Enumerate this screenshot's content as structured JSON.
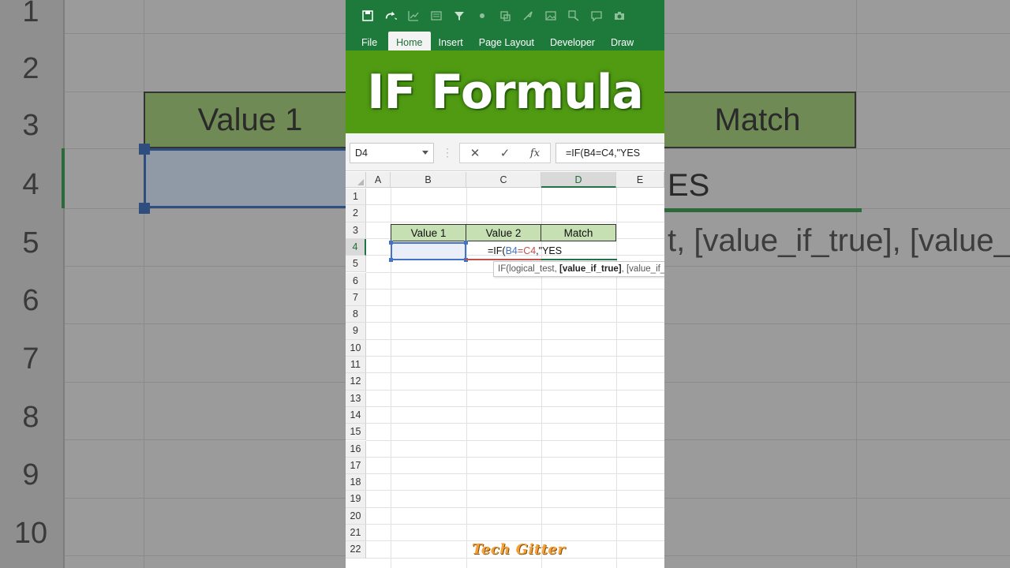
{
  "app": {
    "name": "Excel"
  },
  "quick_access": [
    {
      "icon": "autosave-icon"
    },
    {
      "icon": "redo-icon"
    },
    {
      "icon": "chart-icon"
    },
    {
      "icon": "form-icon"
    },
    {
      "icon": "filter-icon"
    },
    {
      "icon": "circle-icon"
    },
    {
      "icon": "shapes-icon"
    },
    {
      "icon": "brush-icon"
    },
    {
      "icon": "picture-icon"
    },
    {
      "icon": "replace-icon"
    },
    {
      "icon": "comment-icon"
    },
    {
      "icon": "camera-icon"
    }
  ],
  "ribbon": {
    "tabs": [
      {
        "label": "File"
      },
      {
        "label": "Home",
        "active": true
      },
      {
        "label": "Insert"
      },
      {
        "label": "Page Layout"
      },
      {
        "label": "Developer"
      },
      {
        "label": "Draw"
      }
    ]
  },
  "banner": {
    "title": "IF Formula"
  },
  "formula_bar": {
    "name_box": "D4",
    "formula": "=IF(B4=C4,\"YES",
    "cancel_icon": "close-icon",
    "enter_icon": "check-icon",
    "function_icon": "fx"
  },
  "sheet": {
    "columns": [
      "A",
      "B",
      "C",
      "D",
      "E"
    ],
    "active_column": "D",
    "rows": [
      "1",
      "2",
      "3",
      "4",
      "5",
      "6",
      "7",
      "8",
      "9",
      "10",
      "11",
      "12",
      "13",
      "14",
      "15",
      "16",
      "17",
      "18",
      "19",
      "20",
      "21",
      "22"
    ],
    "active_row": "4",
    "headers": [
      "Value 1",
      "Value 2",
      "Match"
    ],
    "editing_cell": {
      "prefix": "=IF(",
      "ref1": "B4",
      "op": "=",
      "ref2": "C4",
      "suffix": ",\"YES"
    },
    "tooltip": {
      "fn": "IF(logical_test, ",
      "current_arg": "[value_if_true]",
      "rest": ", [value_if_false])"
    }
  },
  "background": {
    "row_numbers": [
      "1",
      "2",
      "3",
      "4",
      "5",
      "6",
      "7",
      "8",
      "9",
      "10"
    ],
    "header_left": "Value 1",
    "header_right": "Match",
    "cell_right": "ES",
    "tooltip_fragment": "t, [value_if_true], [value_"
  },
  "watermark": "Tech Gitter",
  "colors": {
    "excel_green": "#1e7a3a",
    "banner_green": "#519b13",
    "header_fill": "#c6e0b4",
    "ref_blue": "#4472c4",
    "ref_red": "#c0504d"
  }
}
